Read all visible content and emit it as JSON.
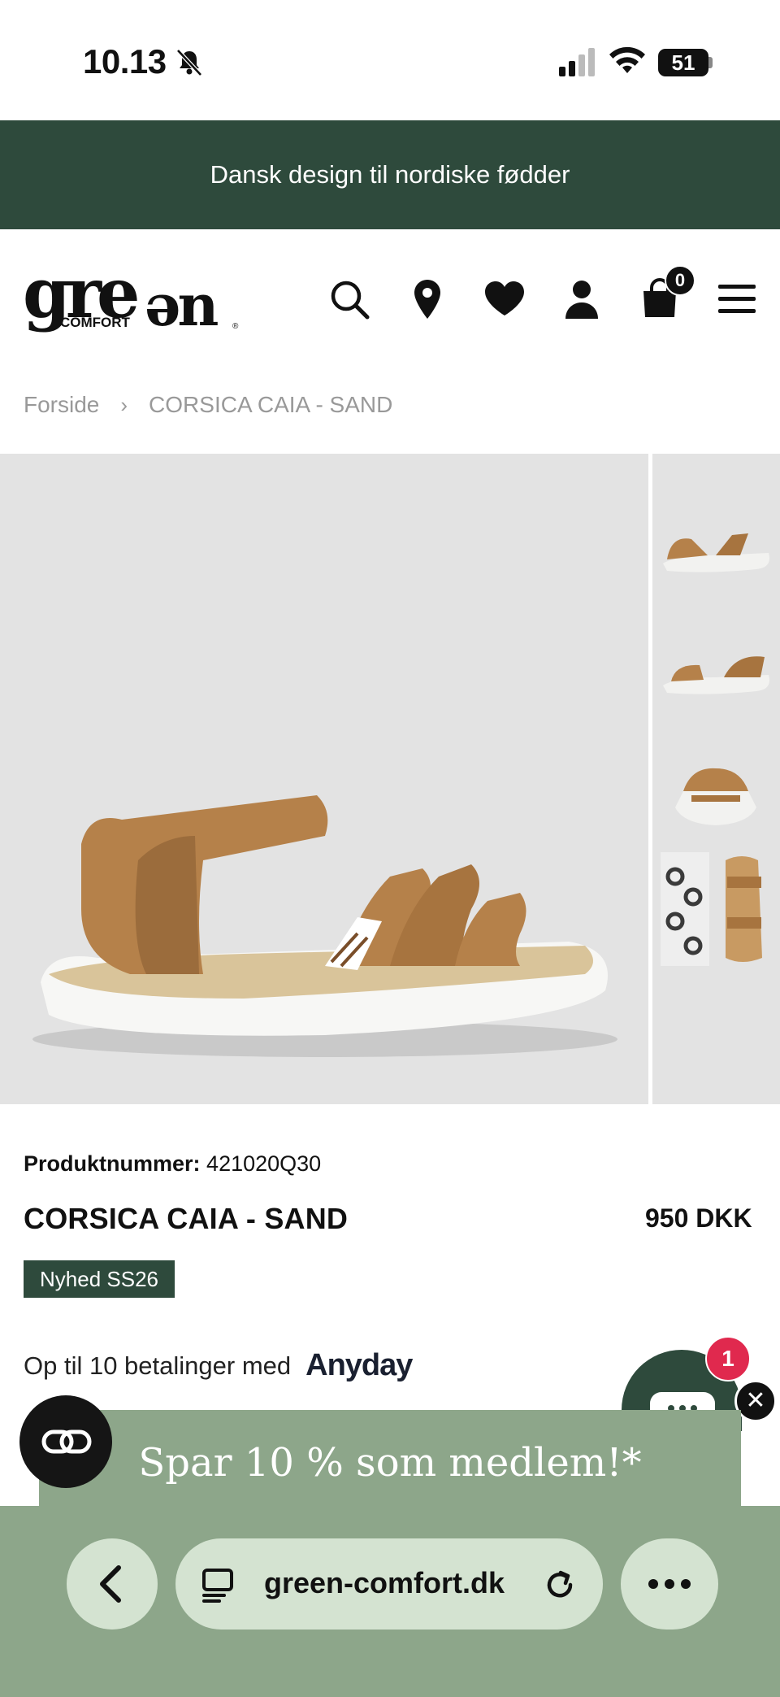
{
  "status_bar": {
    "time": "10.13",
    "battery": "51"
  },
  "banner": {
    "text": "Dansk design til nordiske fødder"
  },
  "header": {
    "logo_text": "green",
    "logo_sub": "COMFORT",
    "cart_count": "0",
    "icons": [
      "search-icon",
      "location-pin-icon",
      "heart-icon",
      "user-icon",
      "shopping-bag-icon",
      "hamburger-menu-icon"
    ]
  },
  "breadcrumb": {
    "home": "Forside",
    "separator": "›",
    "current": "CORSICA CAIA - SAND"
  },
  "product": {
    "sku_label": "Produktnummer:",
    "sku_value": "421020Q30",
    "title": "CORSICA CAIA - SAND",
    "price": "950 DKK",
    "badge": "Nyhed SS26",
    "installments_text": "Op til 10 betalinger med",
    "installments_brand": "Anyday"
  },
  "chat": {
    "unread_count": "1"
  },
  "promo": {
    "text": "Spar 10 % som medlem!*"
  },
  "browser": {
    "url": "green-comfort.dk"
  },
  "colors": {
    "brand_green": "#2e4a3c",
    "sage": "#8da68a",
    "pill": "#d4e3d1",
    "badge_red": "#e0294e"
  }
}
